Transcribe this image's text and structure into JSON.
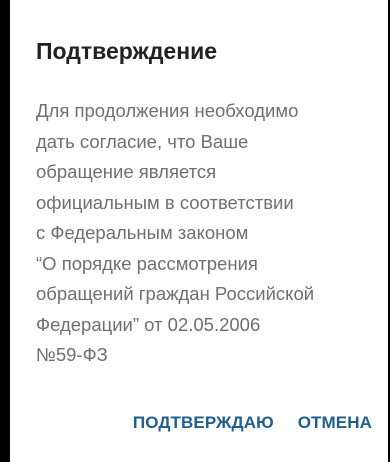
{
  "dialog": {
    "title": "Подтверждение",
    "message_lines": [
      "Для продолжения необходимо",
      "дать согласие, что Ваше",
      "обращение является",
      "официальным в соответствии",
      "с Федеральным законом",
      "“О порядке рассмотрения",
      "обращений граждан Российской",
      "Федерации” от 02.05.2006",
      "№59-ФЗ"
    ],
    "confirm_label": "ПОДТВЕРЖДАЮ",
    "cancel_label": "ОТМЕНА"
  },
  "colors": {
    "accent": "#1f5e8f",
    "title": "#222222",
    "text": "#6f6f6f",
    "background": "#ffffff"
  }
}
